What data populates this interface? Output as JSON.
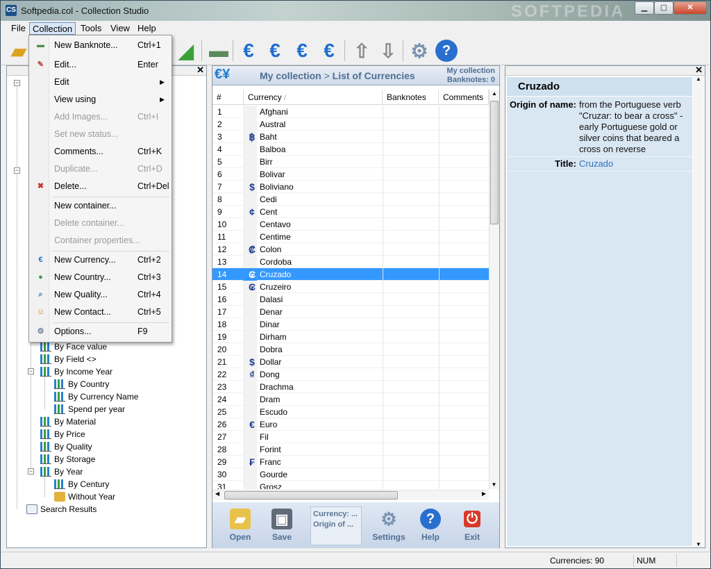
{
  "window": {
    "title": "Softpedia.col - Collection Studio",
    "app_icon": "CS",
    "watermark": "SOFTPEDIA"
  },
  "menubar": [
    "File",
    "Collection",
    "Tools",
    "View",
    "Help"
  ],
  "collection_menu": [
    {
      "label": "New Banknote...",
      "shortcut": "Ctrl+1",
      "icon": "banknote-add-icon",
      "disabled": false
    },
    {
      "label": "Edit...",
      "shortcut": "Enter",
      "icon": "edit-icon",
      "disabled": false
    },
    {
      "label": "Edit",
      "shortcut": "",
      "submenu": true,
      "disabled": false
    },
    {
      "label": "View using",
      "shortcut": "",
      "submenu": true,
      "disabled": false
    },
    {
      "label": "Add Images...",
      "shortcut": "Ctrl+I",
      "disabled": true
    },
    {
      "label": "Set new status...",
      "shortcut": "",
      "disabled": true
    },
    {
      "label": "Comments...",
      "shortcut": "Ctrl+K",
      "disabled": false
    },
    {
      "label": "Duplicate...",
      "shortcut": "Ctrl+D",
      "disabled": true
    },
    {
      "label": "Delete...",
      "shortcut": "Ctrl+Del",
      "icon": "delete-icon",
      "disabled": false
    },
    {
      "label": "New container...",
      "shortcut": "",
      "disabled": false
    },
    {
      "label": "Delete container...",
      "shortcut": "",
      "disabled": true
    },
    {
      "label": "Container properties...",
      "shortcut": "",
      "disabled": true
    },
    {
      "label": "New Currency...",
      "shortcut": "Ctrl+2",
      "icon": "currency-icon",
      "disabled": false
    },
    {
      "label": "New Country...",
      "shortcut": "Ctrl+3",
      "icon": "globe-icon",
      "disabled": false
    },
    {
      "label": "New Quality...",
      "shortcut": "Ctrl+4",
      "icon": "magnifier-icon",
      "disabled": false
    },
    {
      "label": "New Contact...",
      "shortcut": "Ctrl+5",
      "icon": "contact-icon",
      "disabled": false
    },
    {
      "label": "Options...",
      "shortcut": "F9",
      "icon": "options-icon",
      "disabled": false
    }
  ],
  "tree": [
    "By Face value",
    "By Field <>",
    "By Income Year",
    "By Country",
    "By Currency Name",
    "Spend per year",
    "By Material",
    "By Price",
    "By Quality",
    "By Storage",
    "By Year",
    "By Century",
    "Without Year",
    "Search Results"
  ],
  "center": {
    "breadcrumb_root": "My collection",
    "breadcrumb_sep": ">",
    "breadcrumb_leaf": "List of Currencies",
    "info_line1": "My collection",
    "info_line2": "Banknotes: 0",
    "columns": [
      "#",
      "Currency",
      "Banknotes",
      "Comments"
    ],
    "sort_indicator": "/",
    "rows": [
      {
        "n": "1",
        "sym": "",
        "name": "Afghani"
      },
      {
        "n": "2",
        "sym": "",
        "name": "Austral"
      },
      {
        "n": "3",
        "sym": "฿",
        "name": "Baht"
      },
      {
        "n": "4",
        "sym": "",
        "name": "Balboa"
      },
      {
        "n": "5",
        "sym": "",
        "name": "Birr"
      },
      {
        "n": "6",
        "sym": "",
        "name": "Bolivar"
      },
      {
        "n": "7",
        "sym": "$",
        "name": "Boliviano"
      },
      {
        "n": "8",
        "sym": "",
        "name": "Cedi"
      },
      {
        "n": "9",
        "sym": "¢",
        "name": "Cent"
      },
      {
        "n": "10",
        "sym": "",
        "name": "Centavo"
      },
      {
        "n": "11",
        "sym": "",
        "name": "Centime"
      },
      {
        "n": "12",
        "sym": "₡",
        "name": "Colon"
      },
      {
        "n": "13",
        "sym": "",
        "name": "Cordoba"
      },
      {
        "n": "14",
        "sym": "₢",
        "name": "Cruzado",
        "selected": true
      },
      {
        "n": "15",
        "sym": "₢",
        "name": "Cruzeiro"
      },
      {
        "n": "16",
        "sym": "",
        "name": "Dalasi"
      },
      {
        "n": "17",
        "sym": "",
        "name": "Denar"
      },
      {
        "n": "18",
        "sym": "",
        "name": "Dinar"
      },
      {
        "n": "19",
        "sym": "",
        "name": "Dirham"
      },
      {
        "n": "20",
        "sym": "",
        "name": "Dobra"
      },
      {
        "n": "21",
        "sym": "$",
        "name": "Dollar"
      },
      {
        "n": "22",
        "sym": "₫",
        "name": "Dong"
      },
      {
        "n": "23",
        "sym": "",
        "name": "Drachma"
      },
      {
        "n": "24",
        "sym": "",
        "name": "Dram"
      },
      {
        "n": "25",
        "sym": "",
        "name": "Escudo"
      },
      {
        "n": "26",
        "sym": "€",
        "name": "Euro"
      },
      {
        "n": "27",
        "sym": "",
        "name": "Fil"
      },
      {
        "n": "28",
        "sym": "",
        "name": "Forint"
      },
      {
        "n": "29",
        "sym": "₣",
        "name": "Franc"
      },
      {
        "n": "30",
        "sym": "",
        "name": "Gourde"
      },
      {
        "n": "31",
        "sym": "",
        "name": "Grosz"
      }
    ],
    "buttons": [
      "Open",
      "Save",
      "Settings",
      "Help",
      "Exit"
    ],
    "mini_info_line1": "Currency: ...",
    "mini_info_line2": "Origin of ..."
  },
  "details": {
    "title": "Cruzado",
    "origin_label": "Origin of name:",
    "origin_value": "from the Portuguese verb \"Cruzar: to bear a cross\" - early Portuguese gold or silver coins that beared a cross on reverse",
    "title_label": "Title:",
    "title_value": "Cruzado"
  },
  "status": {
    "currencies": "Currencies: 90",
    "num": "NUM"
  },
  "colors": {
    "selection": "#3399ff",
    "header_text": "#4f6e92",
    "link": "#2d6fb7"
  }
}
